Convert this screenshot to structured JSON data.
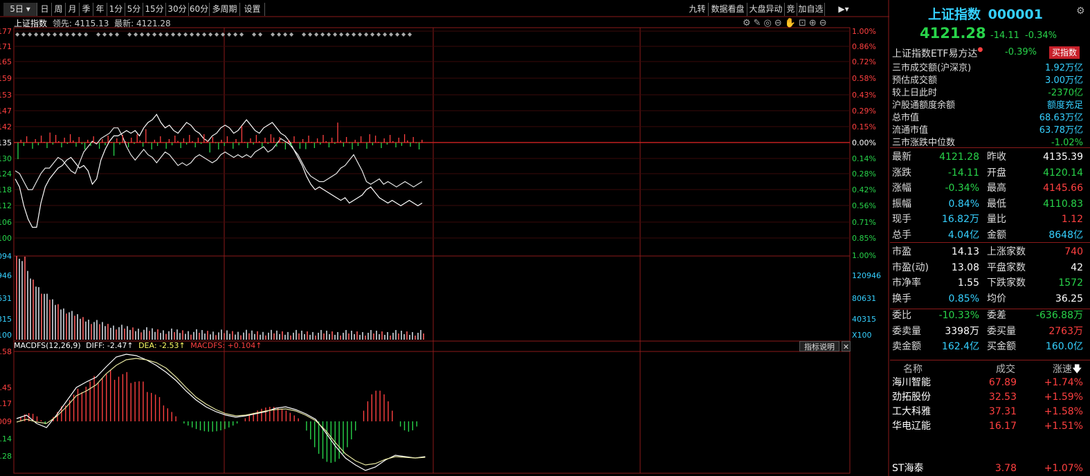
{
  "toolbar": {
    "period_selected": "5日",
    "periods": [
      "日",
      "周",
      "月",
      "季",
      "年",
      "1分",
      "5分",
      "15分",
      "30分",
      "60分",
      "多周期",
      "设置"
    ],
    "right_buttons": [
      "九转",
      "数据看盘",
      "大盘异动",
      "竞",
      "加自选"
    ]
  },
  "chart_header": {
    "name": "上证指数",
    "lead_label": "领先:",
    "lead_value": "4115.13",
    "latest_label": "最新:",
    "latest_value": "4121.28"
  },
  "price_panel": {
    "y_labels": [
      "177",
      "171",
      "165",
      "159",
      "153",
      "147",
      "142",
      "135",
      "130",
      "124",
      "118",
      "112",
      "106",
      "100"
    ],
    "pct_labels": [
      "1.00%",
      "0.86%",
      "0.72%",
      "0.58%",
      "0.43%",
      "0.29%",
      "0.15%",
      "0.00%",
      "0.14%",
      "0.28%",
      "0.42%",
      "0.56%",
      "0.71%",
      "0.85%",
      "1.00%"
    ]
  },
  "volume_panel": {
    "y_labels": [
      "094",
      "946",
      "631",
      "315",
      "100"
    ],
    "right_labels": [
      "120946",
      "80631",
      "40315",
      "X100"
    ]
  },
  "macd_panel": {
    "title": "MACDFS(12,26,9)",
    "diff_label": "DIFF: -2.47↑",
    "dea_label": "DEA: -2.53↑",
    "macdfs_label": "MACDFS: +0.104↑",
    "explain_button": "指标说明",
    "y_labels": [
      "4.58",
      "2.45",
      "1.17",
      "0.009",
      "0.14",
      "2.28"
    ]
  },
  "chart_data": {
    "type": "line",
    "series": [
      {
        "name": "",
        "values": [
          122,
          119,
          112,
          107,
          104,
          104,
          113,
          119,
          122,
          124,
          126,
          127,
          129,
          130,
          128,
          126,
          127,
          125,
          120,
          122,
          129,
          133,
          136,
          138,
          138,
          139,
          140,
          139,
          140,
          138,
          141,
          143,
          144,
          146,
          143,
          141,
          142,
          140,
          139,
          141,
          143,
          142,
          140,
          139,
          137,
          136,
          138,
          139,
          141,
          142,
          141,
          139,
          140,
          142,
          144,
          142,
          140,
          139,
          141,
          142,
          143,
          141,
          139,
          138,
          136,
          133,
          130,
          127,
          123,
          120,
          118,
          119,
          118,
          117,
          116,
          115,
          114,
          115,
          113,
          114,
          115,
          116,
          118,
          119,
          117,
          115,
          114,
          113,
          114,
          113,
          112,
          113,
          114,
          113,
          112,
          113
        ]
      },
      {
        "name": "",
        "values": [
          125,
          124,
          121,
          118,
          118,
          121,
          124,
          126,
          126,
          128,
          130,
          129,
          127,
          125,
          124,
          128,
          132,
          134,
          136,
          135,
          137,
          138,
          139,
          141,
          141,
          138,
          134,
          131,
          129,
          131,
          133,
          131,
          130,
          128,
          130,
          132,
          131,
          129,
          127,
          128,
          127,
          128,
          130,
          131,
          130,
          129,
          128,
          129,
          131,
          132,
          131,
          130,
          131,
          130,
          131,
          130,
          132,
          133,
          134,
          132,
          133,
          135,
          137,
          136,
          135,
          133,
          131,
          128,
          125,
          123,
          122,
          121,
          121,
          122,
          123,
          124,
          126,
          127,
          129,
          131,
          128,
          125,
          121,
          120,
          121,
          122,
          120,
          121,
          120,
          119,
          120,
          121,
          120,
          119,
          120,
          121
        ]
      }
    ]
  },
  "info_panel": {
    "index_name": "上证指数",
    "index_code": "000001",
    "price": "4121.28",
    "change": "-14.11",
    "change_pct": "-0.34%",
    "etf_name": "上证指数ETF易方达",
    "etf_pct": "-0.39%",
    "buy_button": "买指数",
    "stats": [
      {
        "label": "三市成交额(沪深京)",
        "value": "1.92万亿",
        "color": "#35d0ff"
      },
      {
        "label": "预估成交额",
        "value": "3.00万亿",
        "color": "#35d0ff"
      },
      {
        "label": "较上日此时",
        "value": "-2370亿",
        "color": "#28d44a"
      },
      {
        "label": "沪股通额度余额",
        "value": "额度充足",
        "color": "#35d0ff"
      },
      {
        "label": "总市值",
        "value": "68.63万亿",
        "color": "#35d0ff"
      },
      {
        "label": "流通市值",
        "value": "63.78万亿",
        "color": "#35d0ff"
      },
      {
        "label": "三市涨跌中位数",
        "value": "-1.02%",
        "color": "#28d44a"
      }
    ],
    "quote_rows": [
      {
        "l1": "最新",
        "v1": "4121.28",
        "c1": "#28d44a",
        "l2": "昨收",
        "v2": "4135.39",
        "c2": "#ffffff"
      },
      {
        "l1": "涨跌",
        "v1": "-14.11",
        "c1": "#28d44a",
        "l2": "开盘",
        "v2": "4120.14",
        "c2": "#28d44a"
      },
      {
        "l1": "涨幅",
        "v1": "-0.34%",
        "c1": "#28d44a",
        "l2": "最高",
        "v2": "4145.66",
        "c2": "#ff4040"
      },
      {
        "l1": "振幅",
        "v1": "0.84%",
        "c1": "#35d0ff",
        "l2": "最低",
        "v2": "4110.83",
        "c2": "#28d44a"
      },
      {
        "l1": "现手",
        "v1": "16.82万",
        "c1": "#35d0ff",
        "l2": "量比",
        "v2": "1.12",
        "c2": "#ff4040"
      },
      {
        "l1": "总手",
        "v1": "4.04亿",
        "c1": "#35d0ff",
        "l2": "金额",
        "v2": "8648亿",
        "c2": "#35d0ff"
      },
      {
        "l1": "市盈",
        "v1": "14.13",
        "c1": "#ffffff",
        "l2": "上涨家数",
        "v2": "740",
        "c2": "#ff4040"
      },
      {
        "l1": "市盈(动)",
        "v1": "13.08",
        "c1": "#ffffff",
        "l2": "平盘家数",
        "v2": "42",
        "c2": "#ffffff"
      },
      {
        "l1": "市净率",
        "v1": "1.55",
        "c1": "#ffffff",
        "l2": "下跌家数",
        "v2": "1572",
        "c2": "#28d44a"
      },
      {
        "l1": "换手",
        "v1": "0.85%",
        "c1": "#35d0ff",
        "l2": "均价",
        "v2": "36.25",
        "c2": "#ffffff"
      },
      {
        "l1": "委比",
        "v1": "-10.33%",
        "c1": "#28d44a",
        "l2": "委差",
        "v2": "-636.88万",
        "c2": "#28d44a"
      },
      {
        "l1": "委卖量",
        "v1": "3398万",
        "c1": "#ffffff",
        "l2": "委买量",
        "v2": "2763万",
        "c2": "#ff4040"
      },
      {
        "l1": "卖金额",
        "v1": "162.4亿",
        "c1": "#35d0ff",
        "l2": "买金额",
        "v2": "160.0亿",
        "c2": "#35d0ff"
      }
    ],
    "table_headers": [
      "名称",
      "成交",
      "涨速"
    ],
    "stocks": [
      {
        "name": "海川智能",
        "price": "67.89",
        "speed": "+1.74%"
      },
      {
        "name": "劲拓股份",
        "price": "32.53",
        "speed": "+1.59%"
      },
      {
        "name": "工大科雅",
        "price": "37.31",
        "speed": "+1.58%"
      },
      {
        "name": "华电辽能",
        "price": "16.17",
        "speed": "+1.51%"
      },
      {
        "name": "ST海泰",
        "price": "3.78",
        "speed": "+1.07%"
      }
    ]
  }
}
